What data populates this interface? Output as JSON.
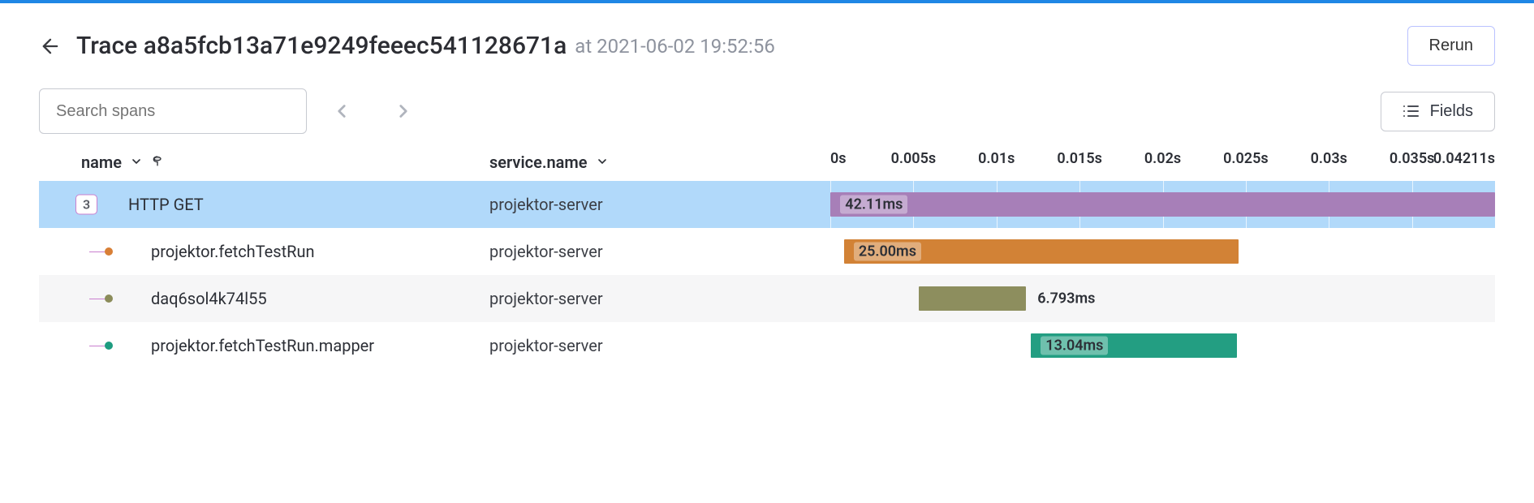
{
  "header": {
    "title_prefix": "Trace",
    "trace_id": "a8a5fcb13a71e9249feeec541128671a",
    "timestamp_prefix": "at",
    "timestamp": "2021-06-02 19:52:56",
    "rerun_label": "Rerun"
  },
  "toolbar": {
    "search_placeholder": "Search spans",
    "fields_label": "Fields"
  },
  "columns": {
    "name_label": "name",
    "service_label": "service.name"
  },
  "timeline": {
    "total_seconds": 0.04211,
    "ticks": [
      "0s",
      "0.005s",
      "0.01s",
      "0.015s",
      "0.02s",
      "0.025s",
      "0.03s",
      "0.035s",
      "0.04211s"
    ]
  },
  "spans": [
    {
      "name": "HTTP GET",
      "service": "projektor-server",
      "child_count": "3",
      "color": "#a77fb8",
      "start_ms": 0.0,
      "dur_ms": 42.11,
      "label": "42.11ms",
      "label_inside": true,
      "selected": true,
      "depth": 0
    },
    {
      "name": "projektor.fetchTestRun",
      "service": "projektor-server",
      "dot": "dot-orange",
      "color": "#d28236",
      "start_ms": 0.85,
      "dur_ms": 25.0,
      "label": "25.00ms",
      "label_inside": true,
      "depth": 1,
      "alt": false
    },
    {
      "name": "daq6sol4k74l55",
      "service": "projektor-server",
      "dot": "dot-olive",
      "color": "#8d8e5e",
      "start_ms": 5.6,
      "dur_ms": 6.793,
      "label": "6.793ms",
      "label_inside": false,
      "depth": 1,
      "alt": true
    },
    {
      "name": "projektor.fetchTestRun.mapper",
      "service": "projektor-server",
      "dot": "dot-teal",
      "color": "#239e82",
      "start_ms": 12.7,
      "dur_ms": 13.04,
      "label": "13.04ms",
      "label_inside": true,
      "depth": 1,
      "alt": false
    }
  ]
}
